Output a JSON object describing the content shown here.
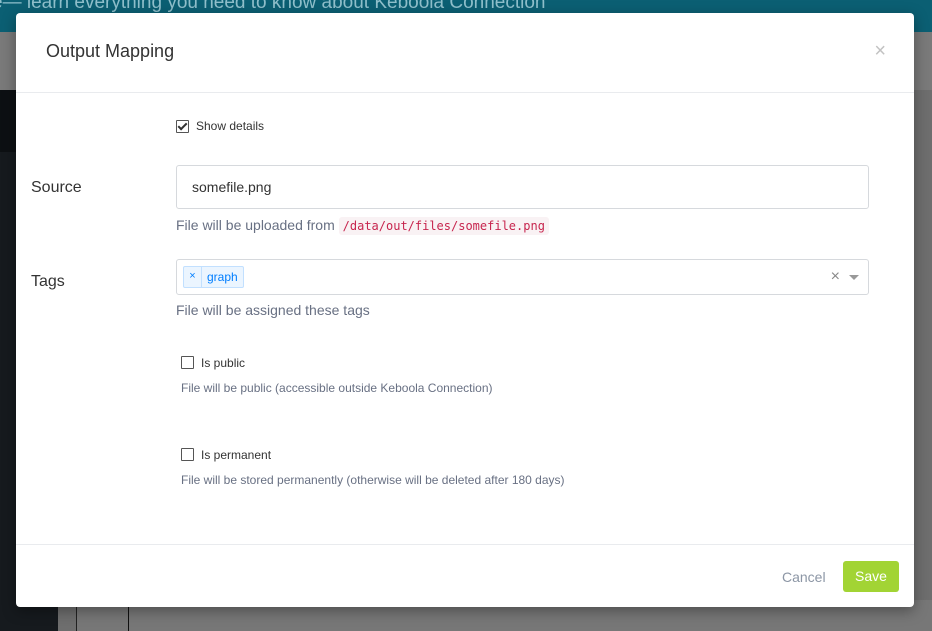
{
  "background": {
    "banner_text": "e— learn everything you need to know about Keboola Connection"
  },
  "modal": {
    "title": "Output Mapping",
    "close_label": "×",
    "show_details_label": "Show details",
    "show_details_checked": true,
    "source": {
      "label": "Source",
      "value": "somefile.png",
      "help_prefix": "File will be uploaded from",
      "help_path": "/data/out/files/somefile.png"
    },
    "tags": {
      "label": "Tags",
      "items": [
        {
          "remove": "×",
          "label": "graph"
        }
      ],
      "clear_label": "×",
      "help": "File will be assigned these tags"
    },
    "is_public": {
      "label": "Is public",
      "checked": false,
      "help": "File will be public (accessible outside Keboola Connection)"
    },
    "is_permanent": {
      "label": "Is permanent",
      "checked": false,
      "help": "File will be stored permanently (otherwise will be deleted after 180 days)"
    },
    "footer": {
      "cancel_label": "Cancel",
      "save_label": "Save"
    }
  },
  "colors": {
    "save_button": "#a2d434",
    "tag_text": "#007eff",
    "help_text": "#687083"
  }
}
